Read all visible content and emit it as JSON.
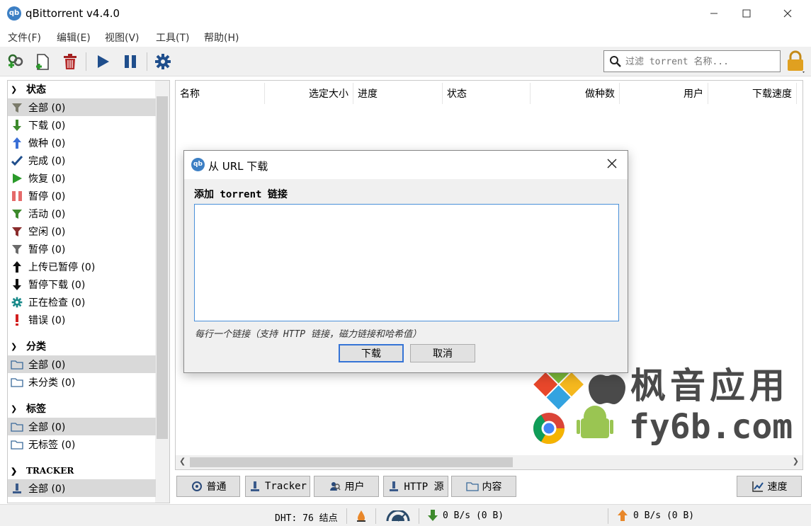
{
  "window": {
    "title": "qBittorrent v4.4.0",
    "icon_text": "qb"
  },
  "menu": [
    "文件(F)",
    "编辑(E)",
    "视图(V)",
    "工具(T)",
    "帮助(H)"
  ],
  "search": {
    "placeholder": "过滤 torrent 名称..."
  },
  "sidebar": {
    "status": {
      "title": "状态",
      "items": [
        {
          "label": "全部 (0)",
          "icon": "filter-icon",
          "selected": true
        },
        {
          "label": "下载 (0)",
          "icon": "download-arrow-icon"
        },
        {
          "label": "做种 (0)",
          "icon": "upload-arrow-icon"
        },
        {
          "label": "完成 (0)",
          "icon": "checkmark-icon"
        },
        {
          "label": "恢复 (0)",
          "icon": "play-icon"
        },
        {
          "label": "暂停 (0)",
          "icon": "pause-icon"
        },
        {
          "label": "活动 (0)",
          "icon": "filter-green-icon"
        },
        {
          "label": "空闲 (0)",
          "icon": "filter-red-icon"
        },
        {
          "label": "暂停 (0)",
          "icon": "filter-gray-icon"
        },
        {
          "label": "上传已暂停 (0)",
          "icon": "up-arrow-icon"
        },
        {
          "label": "暂停下载 (0)",
          "icon": "down-arrow-icon"
        },
        {
          "label": "正在检查 (0)",
          "icon": "gear-icon"
        },
        {
          "label": "错误 (0)",
          "icon": "exclamation-icon"
        }
      ]
    },
    "category": {
      "title": "分类",
      "items": [
        {
          "label": "全部 (0)",
          "icon": "folder-icon",
          "selected": true
        },
        {
          "label": "未分类 (0)",
          "icon": "folder-icon"
        }
      ]
    },
    "tags": {
      "title": "标签",
      "items": [
        {
          "label": "全部 (0)",
          "icon": "folder-icon",
          "selected": true
        },
        {
          "label": "无标签 (0)",
          "icon": "folder-icon"
        }
      ]
    },
    "tracker": {
      "title": "TRACKER",
      "items": [
        {
          "label": "全部 (0)",
          "icon": "tracker-icon",
          "selected": true
        }
      ]
    }
  },
  "columns": [
    "名称",
    "选定大小",
    "进度",
    "状态",
    "做种数",
    "用户",
    "下载速度"
  ],
  "bottom_tabs": [
    "普通",
    "Tracker",
    "用户",
    "HTTP 源",
    "内容"
  ],
  "speed_button": "速度",
  "statusbar": {
    "dht": "DHT: 76 结点",
    "down": "0 B/s (0 B)",
    "up": "0 B/s (0 B)"
  },
  "dialog": {
    "title": "从 URL 下载",
    "label": "添加 torrent 链接",
    "textarea_value": "",
    "hint": "每行一个链接（支持 HTTP 链接，磁力链接和哈希值）",
    "ok": "下载",
    "cancel": "取消"
  },
  "watermark": {
    "line1": "枫音应用",
    "line2": "fy6b.com"
  },
  "colors": {
    "accent": "#3574d6",
    "selection": "#d9d9d9",
    "lock": "#e0a020"
  }
}
